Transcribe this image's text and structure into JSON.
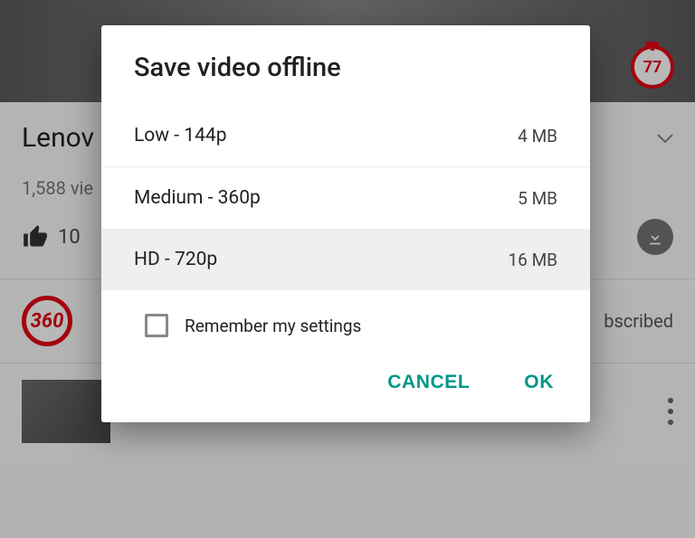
{
  "dialog": {
    "title": "Save video offline",
    "options": [
      {
        "label": "Low - 144p",
        "size": "4 MB"
      },
      {
        "label": "Medium - 360p",
        "size": "5 MB"
      },
      {
        "label": "HD - 720p",
        "size": "16 MB"
      }
    ],
    "remember_label": "Remember my settings",
    "cancel_label": "CANCEL",
    "ok_label": "OK"
  },
  "background": {
    "timer_value": "77",
    "video_title_partial": "Lenov",
    "views_partial": "1,588 vie",
    "like_count": "10",
    "channel_avatar_text": "360",
    "subscribe_partial": "bscribed"
  }
}
